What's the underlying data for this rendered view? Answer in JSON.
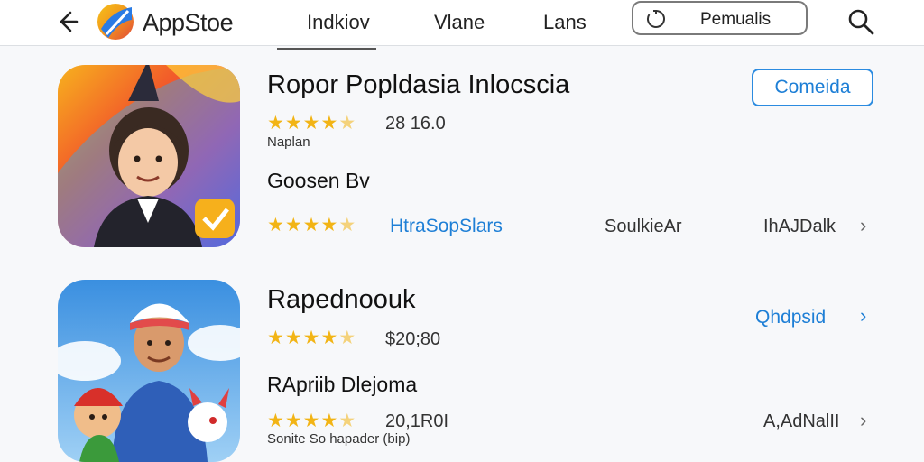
{
  "header": {
    "brand": "AppStoe",
    "tabs": [
      {
        "label": "Indkiov",
        "active": true
      },
      {
        "label": "Vlane",
        "active": false
      },
      {
        "label": "Lans",
        "active": false
      }
    ],
    "pill_label": "Pemualis",
    "icons": {
      "back": "back-arrow-icon",
      "logo": "app-logo-icon",
      "pill": "refresh-icon",
      "search": "search-icon"
    }
  },
  "apps": [
    {
      "title": "Ropor Popldasia Inlocscia",
      "rating_stars": 4.5,
      "rating_text": "28 16.0",
      "rating_sub": "Naplan",
      "subtitle": "Goosen Bv",
      "row_stars": 4.5,
      "link_text": "HtraSopSlars",
      "meta_mid": "SoulkieAr",
      "meta_right": "IhAJDalk",
      "button_label": "Comeida",
      "badge_icon": "checkmark-badge-icon"
    },
    {
      "title": "Rapednoouk",
      "rating_stars": 4.5,
      "rating_text": "$20;80",
      "subtitle": "RApriib Dlejoma",
      "row_stars": 4.5,
      "rating_text_2": "20,1R0I",
      "rating_sub": "Sonite So hapader (bip)",
      "link_text": "Qhdpsid",
      "meta_right": "A,AdNalII"
    }
  ],
  "colors": {
    "accent": "#1e7fd6",
    "star": "#f2b415",
    "divider": "#d6d9dd"
  }
}
